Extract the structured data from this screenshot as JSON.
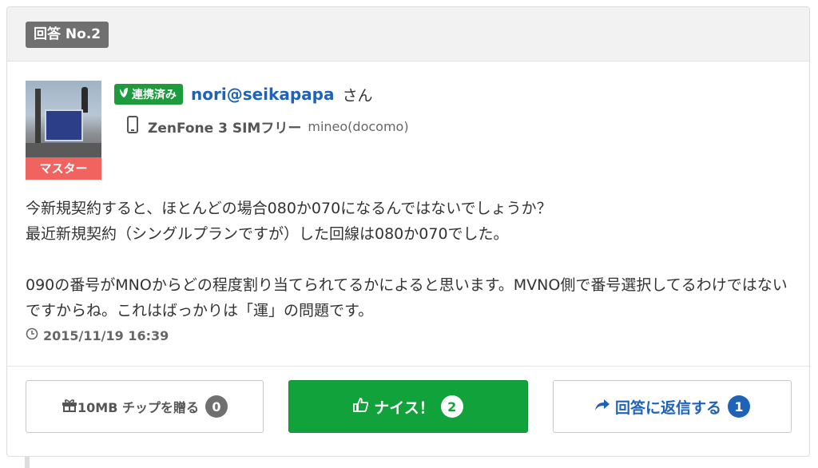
{
  "answer": {
    "label": "回答 No.2",
    "user": {
      "linked_badge": "連携済み",
      "name": "nori@seikapapa",
      "honorific": "さん",
      "rank": "マスター",
      "device": "ZenFone 3 SIMフリー",
      "carrier": "mineo(docomo)"
    },
    "body": [
      "今新規契約すると、ほとんどの場合080か070になるんではないでしょうか？\n最近新規契約（シングルプランですが）した回線は080か070でした。",
      "090の番号がMNOからどの程度割り当てられてるかによると思います。MVNO側で番号選択してるわけではないですからね。これはばっかりは「運」の問題です。"
    ],
    "timestamp": "2015/11/19 16:39",
    "actions": {
      "tip_label": "10MB チップを贈る",
      "tip_count": "0",
      "nice_label": "ナイス！",
      "nice_count": "2",
      "reply_label": "回答に返信する",
      "reply_count": "1"
    }
  },
  "colors": {
    "accent_green": "#12a23b",
    "link_blue": "#1f63b8",
    "rank_red": "#f0635f",
    "badge_gray": "#707070"
  },
  "icons": [
    "leaf-icon",
    "phone-icon",
    "clock-icon",
    "gift-icon",
    "thumbs-up-icon",
    "share-arrow-icon"
  ]
}
